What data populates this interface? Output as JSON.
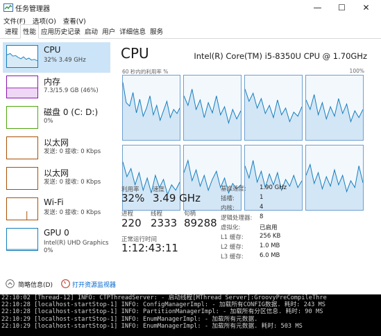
{
  "window": {
    "title": "任务管理器",
    "minimize": "—",
    "maximize": "☐",
    "close": "✕"
  },
  "menu": [
    "文件(F)",
    "选项(O)",
    "查看(V)"
  ],
  "tabs": [
    "进程",
    "性能",
    "应用历史记录",
    "启动",
    "用户",
    "详细信息",
    "服务"
  ],
  "active_tab": 1,
  "sidebar": [
    {
      "name": "CPU",
      "sub": "32% 3.49 GHz",
      "color": "#117dbb"
    },
    {
      "name": "内存",
      "sub": "7.3/15.9 GB (46%)",
      "color": "#8b12ae"
    },
    {
      "name": "磁盘 0 (C: D:)",
      "sub": "0%",
      "color": "#4da60c"
    },
    {
      "name": "以太网",
      "sub": "发送: 0 接收: 0 Kbps",
      "color": "#a74f01"
    },
    {
      "name": "以太网",
      "sub": "发送: 0 接收: 0 Kbps",
      "color": "#a74f01"
    },
    {
      "name": "Wi-Fi",
      "sub": "发送: 0 接收: 0 Kbps",
      "color": "#a74f01"
    },
    {
      "name": "GPU 0",
      "sub": "Intel(R) UHD Graphics",
      "sub2": "0%",
      "color": "#117dbb"
    }
  ],
  "main": {
    "title": "CPU",
    "model": "Intel(R) Core(TM) i5-8350U CPU @ 1.70GHz",
    "chart_left_label": "60 秒内的利用率 %",
    "chart_right_label": "100%",
    "stats": {
      "util_label": "利用率",
      "util_value": "32%",
      "speed_label": "速度",
      "speed_value": "3.49 GHz",
      "proc_label": "进程",
      "proc_value": "220",
      "thread_label": "线程",
      "thread_value": "2333",
      "handle_label": "句柄",
      "handle_value": "89288",
      "uptime_label": "正常运行时间",
      "uptime_value": "1:12:43:11"
    },
    "specs": [
      {
        "k": "基准速度:",
        "v": "1.90 GHz"
      },
      {
        "k": "插槽:",
        "v": "1"
      },
      {
        "k": "内核:",
        "v": "4"
      },
      {
        "k": "逻辑处理器:",
        "v": "8"
      },
      {
        "k": "虚拟化:",
        "v": "已启用"
      },
      {
        "k": "L1 缓存:",
        "v": "256 KB"
      },
      {
        "k": "L2 缓存:",
        "v": "1.0 MB"
      },
      {
        "k": "L3 缓存:",
        "v": "6.0 MB"
      }
    ]
  },
  "footer": {
    "summary": "简略信息(D)",
    "resmon": "打开资源监视器"
  },
  "console": [
    "22:10:02 [Thread-12] INFO: CTPThreadServer: - 启动线程[MThread Server]:GroovyPreCompileThre",
    "22:10:28 [localhost-startStop-1] INFO: ConfigManagerImpl: - 加载所有CONFIG数据. 耗时: 243 MS",
    "22:10:28 [localhost-startStop-1] INFO: PartitionManagerImpl: - 加载所有分区信息. 耗时: 90 MS",
    "22:10:29 [localhost-startStop-1] INFO: EnumManagerImpl: - 加载所有元数据.",
    "22:10:29 [localhost-startStop-1] INFO: EnumManagerImpl: - 加载所有元数据. 耗时: 503 MS"
  ],
  "accent": "#117dbb"
}
